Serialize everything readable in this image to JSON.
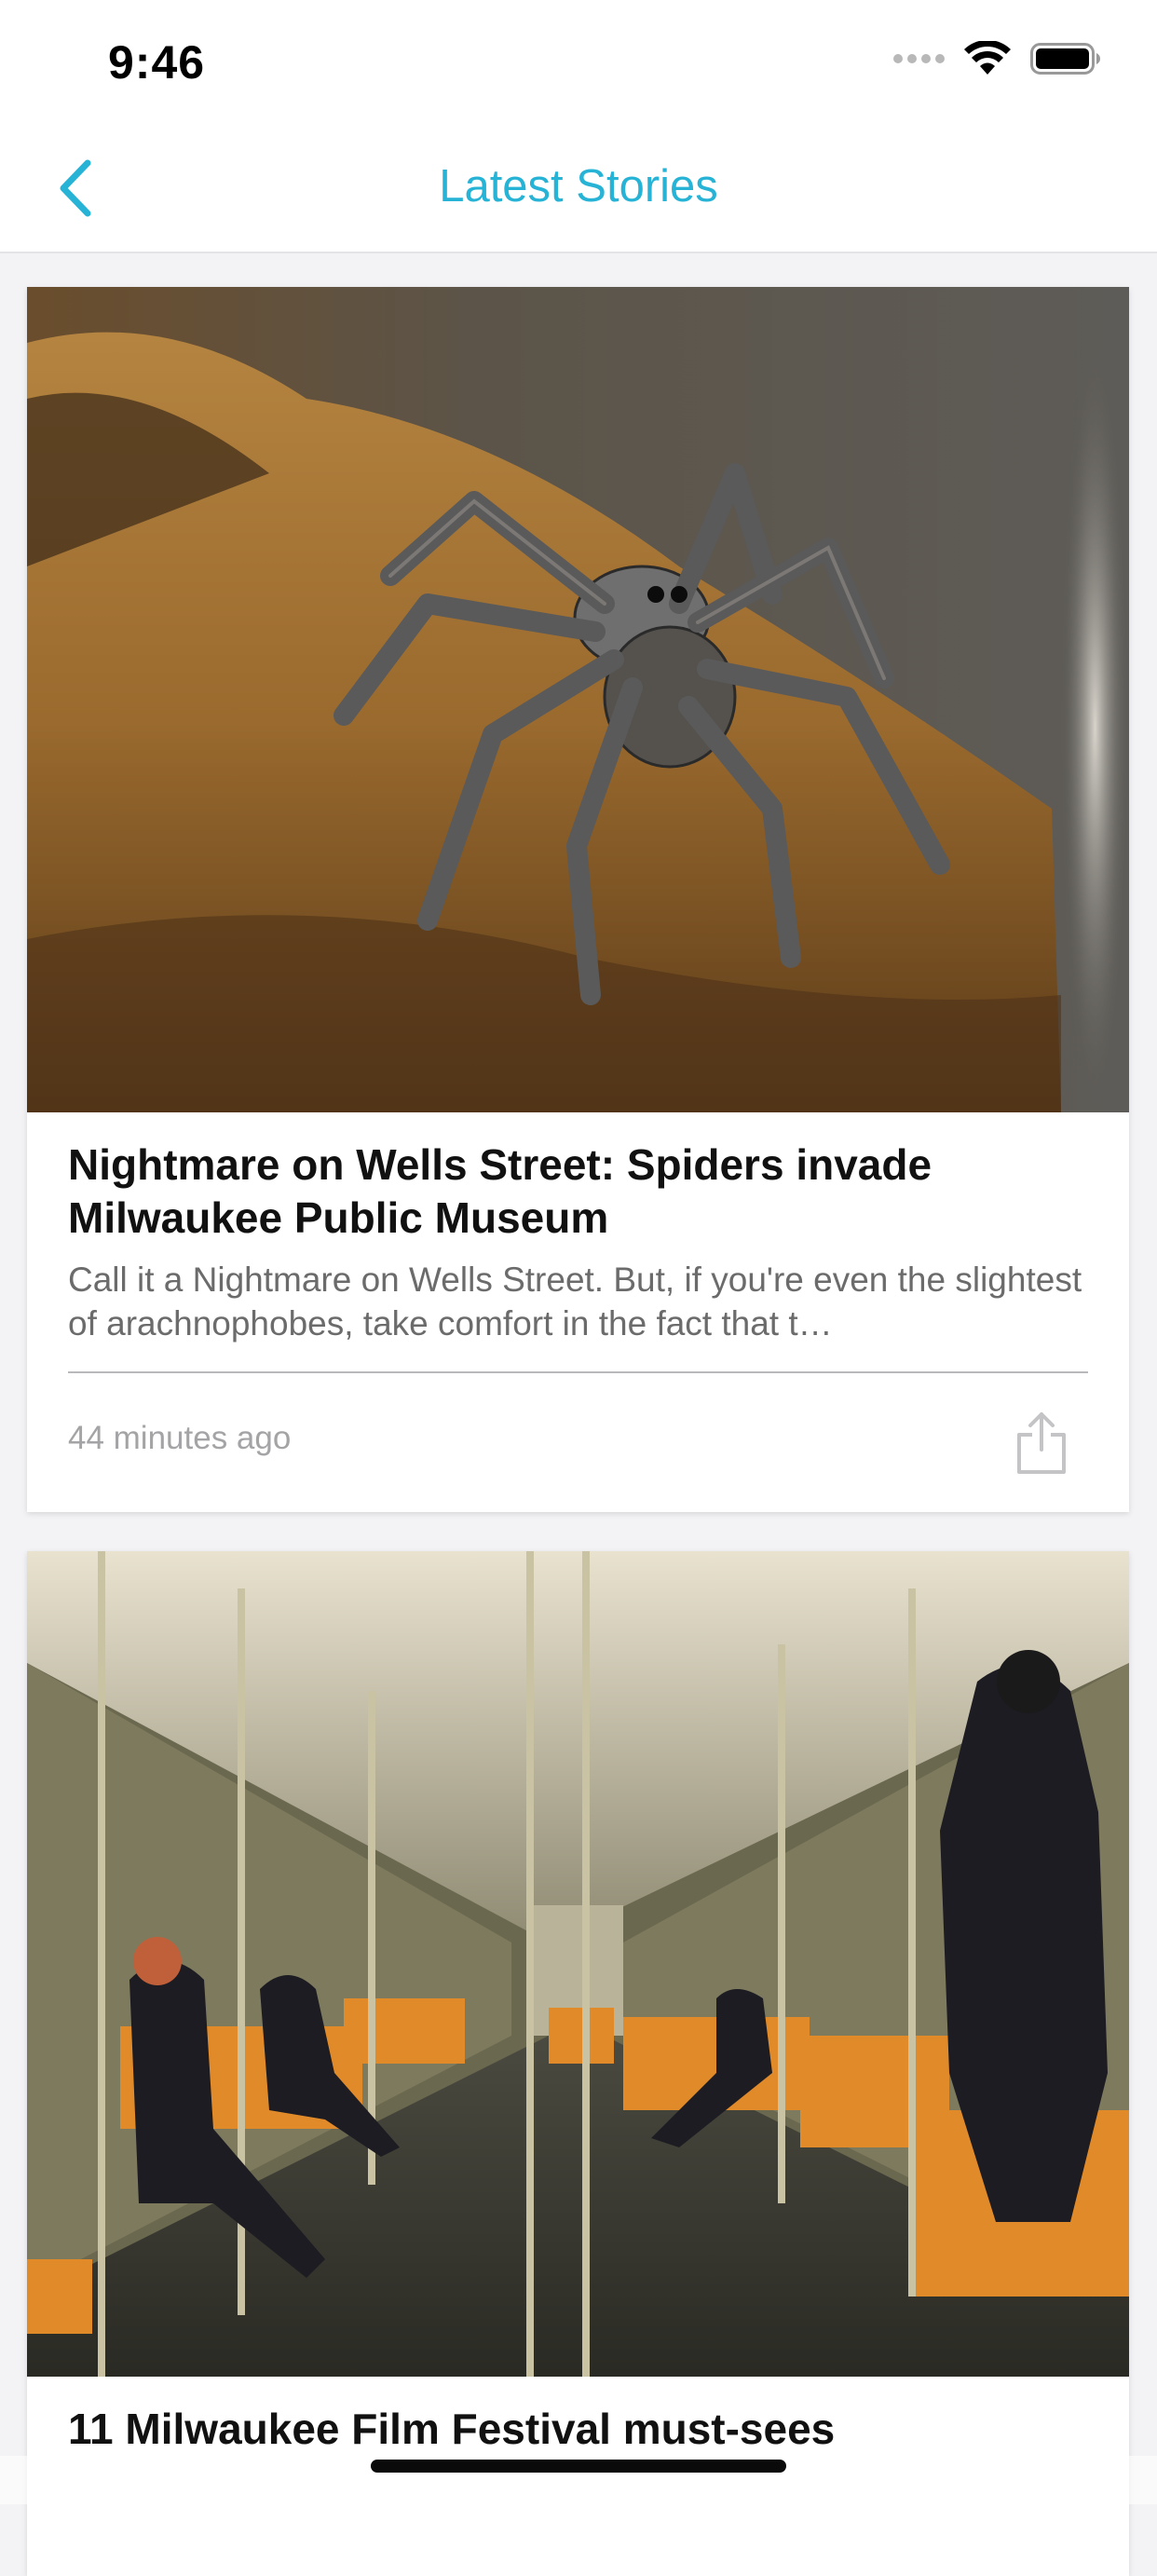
{
  "status_bar": {
    "time": "9:46"
  },
  "nav": {
    "title": "Latest Stories",
    "back_icon": "chevron-left-icon"
  },
  "colors": {
    "accent": "#27b3d6",
    "headline": "#111111",
    "summary": "#6b6b6b",
    "timestamp": "#a4a4a6"
  },
  "stories": [
    {
      "headline": "Nightmare on Wells Street: Spiders invade Milwaukee Public Museum",
      "summary": "Call it a Nightmare on Wells Street. But, if you're even the slightest of arachnophobes, take comfort in the fact that t…",
      "time": "44 minutes ago",
      "share_icon": "share-icon"
    },
    {
      "headline": "11 Milwaukee Film Festival must-sees"
    }
  ]
}
